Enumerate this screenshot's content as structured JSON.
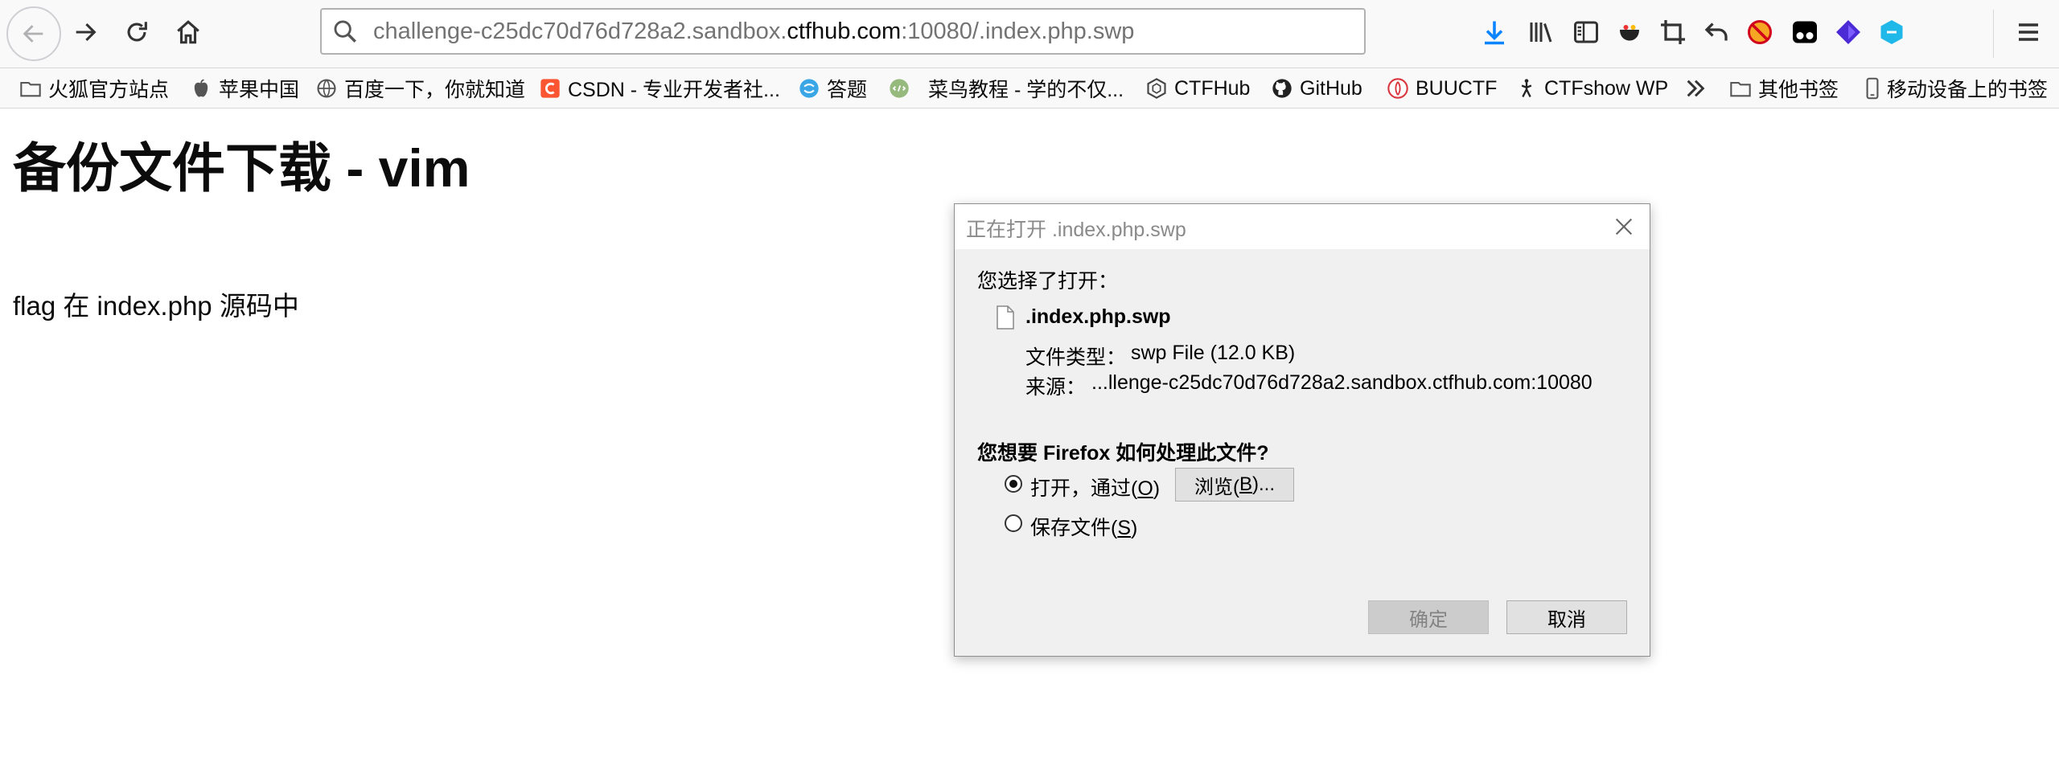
{
  "toolbar": {
    "url_prefix": "challenge-c25dc70d76d728a2.sandbox.",
    "url_domain": "ctfhub.com",
    "url_suffix": ":10080/.index.php.swp",
    "icons": [
      "download-icon",
      "library-icon",
      "sidebar-icon",
      "extension-icon",
      "screenshot-crop-icon",
      "undo-icon",
      "blocker-icon",
      "tampermonkey-icon",
      "extension-diamond-icon",
      "extension-cube-icon",
      "menu-icon"
    ]
  },
  "bookmarks": [
    {
      "label": "火狐官方站点",
      "icon": "folder-icon"
    },
    {
      "label": "苹果中国",
      "icon": "apple-icon"
    },
    {
      "label": "百度一下，你就知道",
      "icon": "globe-icon"
    },
    {
      "label": "CSDN - 专业开发者社...",
      "icon": "csdn-icon"
    },
    {
      "label": "答题",
      "icon": "answer-icon"
    },
    {
      "label": "菜鸟教程 - 学的不仅...",
      "icon": "runoob-icon"
    },
    {
      "label": "CTFHub",
      "icon": "ctfhub-icon"
    },
    {
      "label": "GitHub",
      "icon": "github-icon"
    },
    {
      "label": "BUUCTF",
      "icon": "buuctf-icon"
    },
    {
      "label": "CTFshow WP",
      "icon": "ctfshow-icon"
    },
    {
      "label": "其他书签",
      "icon": "folder-icon"
    },
    {
      "label": "移动设备上的书签",
      "icon": "mobile-icon"
    }
  ],
  "page": {
    "title": "备份文件下载 - vim",
    "text": "flag 在 index.php 源码中"
  },
  "dialog": {
    "title": "正在打开 .index.php.swp",
    "chosen_label": "您选择了打开：",
    "filename": ".index.php.swp",
    "type_label": "文件类型：",
    "type_value": "swp File (12.0 KB)",
    "source_label": "来源：",
    "source_value": "...llenge-c25dc70d76d728a2.sandbox.ctfhub.com:10080",
    "question": "您想要 Firefox 如何处理此文件?",
    "open_with_label": "打开，通过(",
    "open_with_key": "O",
    "browse_label": "浏览(",
    "browse_key": "B",
    "browse_suffix": ")...",
    "save_label": "保存文件(",
    "save_key": "S",
    "paren_close": ")",
    "ok_label": "确定",
    "cancel_label": "取消",
    "selected_option": "open_with"
  }
}
